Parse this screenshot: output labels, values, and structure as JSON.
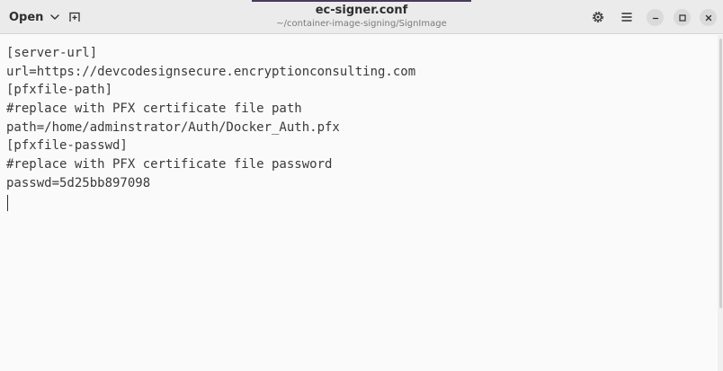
{
  "header": {
    "open_label": "Open",
    "title": "ec-signer.conf",
    "subtitle": "~/container-image-signing/SignImage"
  },
  "icons": {
    "open_chevron": "chevron-down-icon",
    "new_document": "new-document-icon",
    "settings": "gear-icon",
    "menu": "hamburger-menu-icon",
    "minimize": "minimize-icon",
    "maximize": "maximize-icon",
    "close": "close-icon"
  },
  "editor": {
    "lines": [
      "[server-url]",
      "url=https://devcodesignsecure.encryptionconsulting.com",
      "[pfxfile-path]",
      "#replace with PFX certificate file path",
      "path=/home/adminstrator/Auth/Docker_Auth.pfx",
      "[pfxfile-passwd]",
      "#replace with PFX certificate file password",
      "passwd=5d25bb897098"
    ]
  },
  "colors": {
    "headerbar": "#ebebeb",
    "editor_bg": "#fafafa",
    "text": "#3a3a3a",
    "accent": "#4a3a5a"
  }
}
